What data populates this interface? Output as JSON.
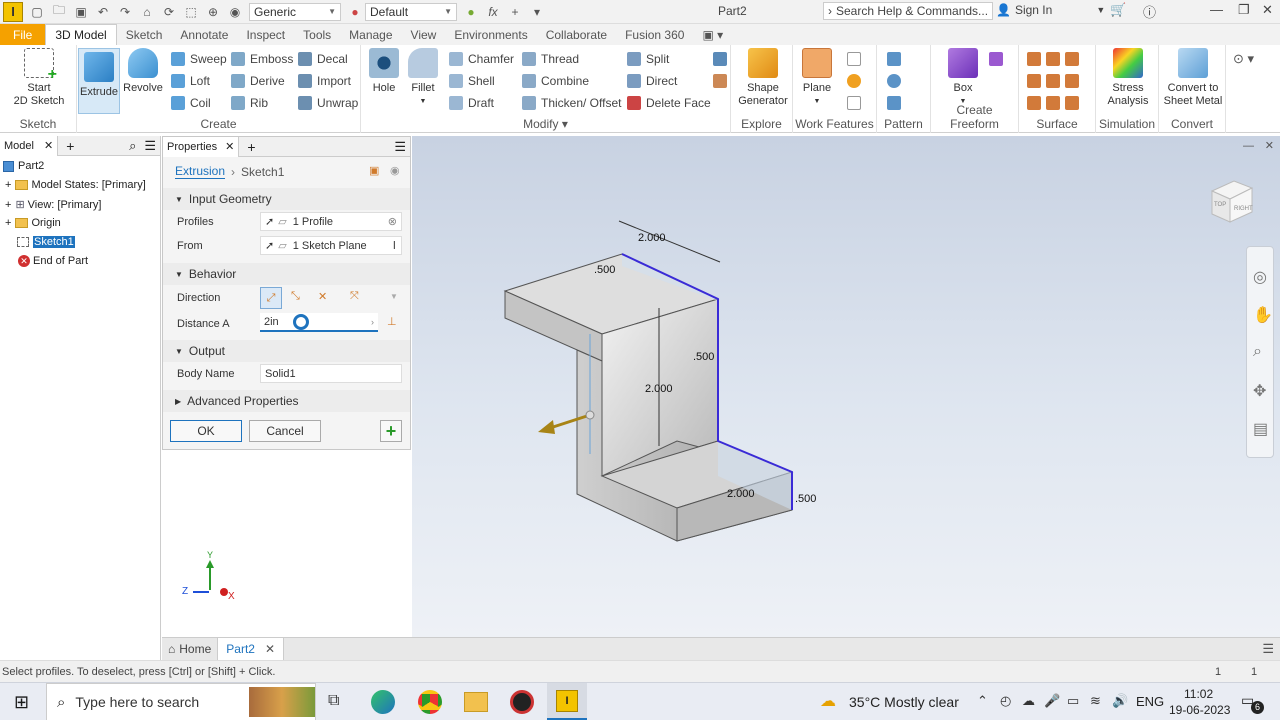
{
  "titlebar": {
    "logo": "I",
    "material": "Generic",
    "appearance": "Default",
    "doc_title": "Part2",
    "search_placeholder": "Search Help & Commands...",
    "sign_in": "Sign In"
  },
  "tabs": [
    "File",
    "3D Model",
    "Sketch",
    "Annotate",
    "Inspect",
    "Tools",
    "Manage",
    "View",
    "Environments",
    "Collaborate",
    "Fusion 360"
  ],
  "ribbon": {
    "sketch": {
      "start_line1": "Start",
      "start_line2": "2D Sketch",
      "label": "Sketch"
    },
    "create": {
      "extrude": "Extrude",
      "revolve": "Revolve",
      "sweep": "Sweep",
      "loft": "Loft",
      "coil": "Coil",
      "emboss": "Emboss",
      "derive": "Derive",
      "rib": "Rib",
      "decal": "Decal",
      "import": "Import",
      "unwrap": "Unwrap",
      "label": "Create"
    },
    "modify": {
      "hole": "Hole",
      "fillet": "Fillet",
      "chamfer": "Chamfer",
      "shell": "Shell",
      "draft": "Draft",
      "thread": "Thread",
      "combine": "Combine",
      "thicken": "Thicken/ Offset",
      "split": "Split",
      "direct": "Direct",
      "delete_face": "Delete Face",
      "label": "Modify ▾"
    },
    "explore": {
      "shape_line1": "Shape",
      "shape_line2": "Generator",
      "label": "Explore"
    },
    "work": {
      "plane": "Plane",
      "label": "Work Features"
    },
    "pattern": {
      "label": "Pattern"
    },
    "freeform": {
      "box": "Box",
      "label": "Create Freeform"
    },
    "surface": {
      "label": "Surface"
    },
    "simulation": {
      "stress_line1": "Stress",
      "stress_line2": "Analysis",
      "label": "Simulation"
    },
    "convert": {
      "line1": "Convert to",
      "line2": "Sheet Metal",
      "label": "Convert"
    }
  },
  "browser": {
    "tab": "Model",
    "items": [
      {
        "label": "Part2"
      },
      {
        "label": "Model States: [Primary]"
      },
      {
        "label": "View: [Primary]"
      },
      {
        "label": "Origin"
      },
      {
        "label": "Sketch1"
      },
      {
        "label": "End of Part"
      }
    ]
  },
  "props": {
    "tab": "Properties",
    "feature": "Extrusion",
    "sketch": "Sketch1",
    "input_geometry": "Input Geometry",
    "profiles_label": "Profiles",
    "profiles_value": "1 Profile",
    "from_label": "From",
    "from_value": "1 Sketch Plane",
    "behavior": "Behavior",
    "direction_label": "Direction",
    "distance_label": "Distance A",
    "distance_value": "2in",
    "output": "Output",
    "body_name_label": "Body Name",
    "body_name_value": "Solid1",
    "advanced": "Advanced Properties",
    "ok": "OK",
    "cancel": "Cancel",
    "add": "+"
  },
  "viewport": {
    "dims": {
      "top_width": "2.000",
      "top_thk": ".500",
      "vert_thk": ".500",
      "height": "2.000",
      "bottom_width": "2.000",
      "bottom_thk": ".500"
    },
    "triad": {
      "y": "Y",
      "z": "Z",
      "x": "X"
    },
    "viewcube_face1": "TOP",
    "viewcube_face2": "RIGHT"
  },
  "doctabs": {
    "home": "Home",
    "part": "Part2"
  },
  "status": {
    "text": "Select profiles. To deselect, press [Ctrl] or [Shift] + Click.",
    "n1": "1",
    "n2": "1"
  },
  "taskbar": {
    "search": "Type here to search",
    "weather": "35°C  Mostly clear",
    "lang": "ENG",
    "time": "11:02",
    "date": "19-06-2023",
    "notif": "6"
  },
  "colors": {
    "file_tab": "#f5a100",
    "accent_blue": "#1e73be",
    "sketch_line": "#3a2bd6",
    "model_gray": "#d6d6d6"
  }
}
